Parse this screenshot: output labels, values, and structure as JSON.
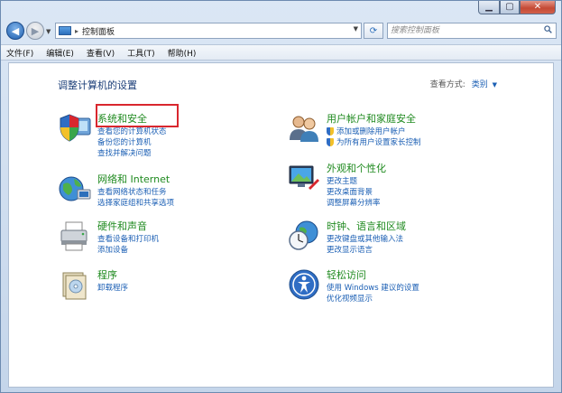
{
  "address": {
    "location": "控制面板",
    "separator": "▸"
  },
  "search": {
    "placeholder": "搜索控制面板"
  },
  "menu": [
    "文件(F)",
    "编辑(E)",
    "查看(V)",
    "工具(T)",
    "帮助(H)"
  ],
  "page": {
    "title": "调整计算机的设置",
    "view_by_label": "查看方式:",
    "view_by_value": "类别"
  },
  "categories": {
    "system_security": {
      "title": "系统和安全",
      "links": [
        "查看您的计算机状态",
        "备份您的计算机",
        "查找并解决问题"
      ]
    },
    "network": {
      "title": "网络和 Internet",
      "links": [
        "查看网络状态和任务",
        "选择家庭组和共享选项"
      ]
    },
    "hardware": {
      "title": "硬件和声音",
      "links": [
        "查看设备和打印机",
        "添加设备"
      ]
    },
    "programs": {
      "title": "程序",
      "links": [
        "卸载程序"
      ]
    },
    "user_accounts": {
      "title": "用户帐户和家庭安全",
      "links": [
        "添加或删除用户帐户",
        "为所有用户设置家长控制"
      ]
    },
    "appearance": {
      "title": "外观和个性化",
      "links": [
        "更改主题",
        "更改桌面背景",
        "调整屏幕分辨率"
      ]
    },
    "clock_region": {
      "title": "时钟、语言和区域",
      "links": [
        "更改键盘或其他输入法",
        "更改显示语言"
      ]
    },
    "ease_access": {
      "title": "轻松访问",
      "links": [
        "使用 Windows 建议的设置",
        "优化视频显示"
      ]
    }
  },
  "colors": {
    "category_title": "#1f8a1f",
    "link": "#1b5fb4",
    "highlight": "#d9272e"
  }
}
